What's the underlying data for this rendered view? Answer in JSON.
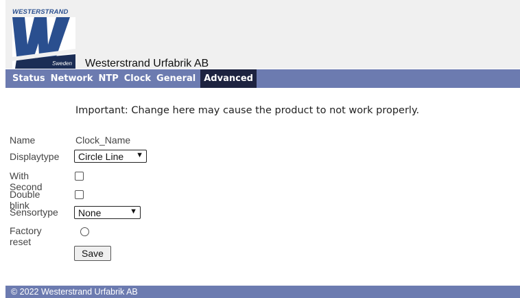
{
  "brand": {
    "logo_text": "WESTERSTRAND",
    "logo_tag": "Sweden",
    "company": "Westerstrand Urfabrik AB"
  },
  "colors": {
    "nav_bg": "#6c7bb0",
    "nav_active_bg": "#1d2340",
    "logo_blue": "#2a4f8f",
    "header_bg": "#f0f0f0"
  },
  "nav": {
    "tabs": [
      "Status",
      "Network",
      "NTP",
      "Clock",
      "General",
      "Advanced"
    ],
    "active": "Advanced"
  },
  "notice": "Important: Change here may cause the product to not work properly.",
  "form": {
    "name_label": "Name",
    "name_value": "Clock_Name",
    "displaytype_label": "Displaytype",
    "displaytype_value": "Circle Line",
    "with_second_label": "With Second",
    "with_second_checked": false,
    "double_blink_label": "Double blink",
    "double_blink_checked": false,
    "sensortype_label": "Sensortype",
    "sensortype_value": "None",
    "factory_reset_label": "Factory reset",
    "factory_reset_selected": false,
    "save_label": "Save"
  },
  "footer": "© 2022 Westerstrand Urfabrik AB"
}
